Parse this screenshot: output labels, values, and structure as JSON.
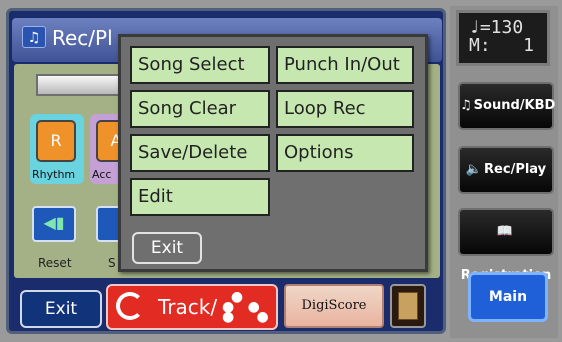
{
  "window": {
    "title": "Rec/Pl",
    "icon": "music-note-icon"
  },
  "background_panel": {
    "parts": [
      {
        "letter": "R",
        "label": "Rhythm"
      },
      {
        "letter": "A",
        "label": "Acc"
      }
    ],
    "reset_label": "Reset",
    "stop_label": "S",
    "reset_icon": "skip-to-start-icon"
  },
  "bottom_bar": {
    "exit_label": "Exit",
    "track_label": "Track/",
    "digiscore_label": "DigiScore",
    "track_icon": "refresh-icon",
    "cabinet_icon": "cabinet-icon"
  },
  "popup": {
    "items": [
      {
        "label": "Song Select"
      },
      {
        "label": "Punch In/Out"
      },
      {
        "label": "Song Clear"
      },
      {
        "label": "Loop Rec"
      },
      {
        "label": "Save/Delete"
      },
      {
        "label": "Options"
      },
      {
        "label": "Edit"
      }
    ],
    "exit_label": "Exit"
  },
  "right_panel": {
    "tempo_line": "♩=130",
    "measure_line": "M:   1",
    "buttons": [
      {
        "label": "Sound/KBD",
        "icon": "music-notes-icon"
      },
      {
        "label": "Rec/Play",
        "icon": "speaker-icon"
      },
      {
        "label": "Registration",
        "icon": "book-icon"
      }
    ],
    "main_label": "Main"
  },
  "colors": {
    "popup_button": "#c6e8b0",
    "main_button": "#1f5fd8",
    "track_button": "#e22b22",
    "part_orange": "#f0922a"
  }
}
